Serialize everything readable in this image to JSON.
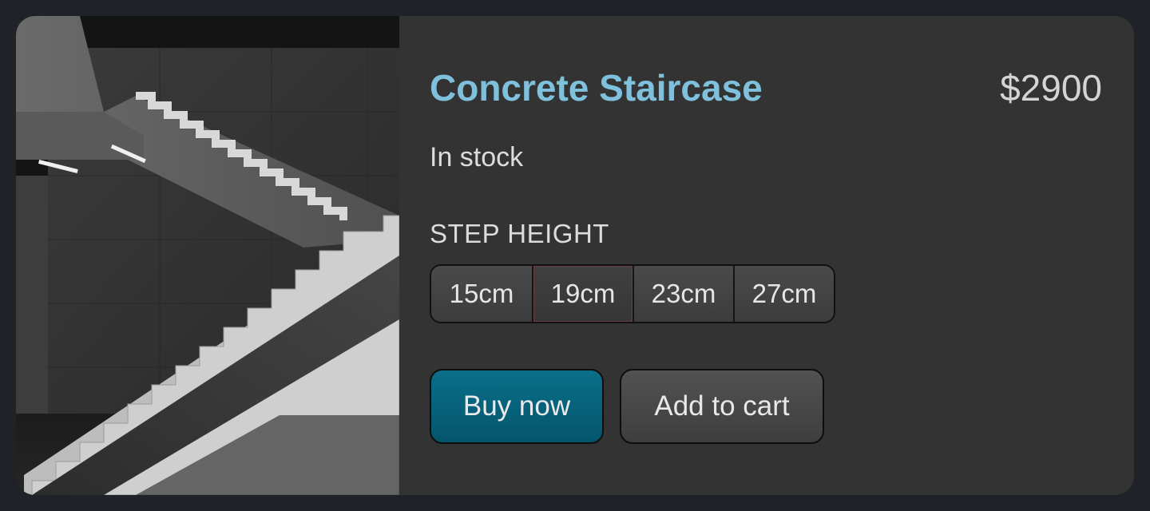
{
  "product": {
    "name": "Concrete Staircase",
    "price": "$2900",
    "availability": "In stock",
    "image": "concrete-staircase-photo"
  },
  "options": {
    "label": "STEP HEIGHT",
    "values": [
      "15cm",
      "19cm",
      "23cm",
      "27cm"
    ],
    "selected": "19cm"
  },
  "actions": {
    "buy_label": "Buy now",
    "cart_label": "Add to cart"
  },
  "colors": {
    "title": "#7fc1dc",
    "buy_button": "#04556c",
    "card_background": "#333333",
    "page_background": "#1f2328"
  }
}
